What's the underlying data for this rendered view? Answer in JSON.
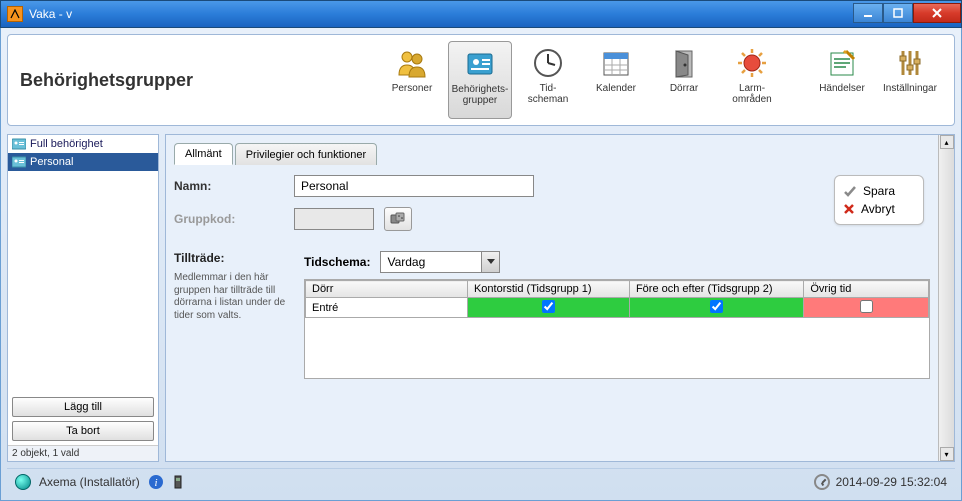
{
  "window": {
    "title": "Vaka - v"
  },
  "ribbon": {
    "title": "Behörighetsgrupper",
    "items": [
      {
        "label": "Personer"
      },
      {
        "label": "Behörighets-\ngrupper"
      },
      {
        "label": "Tid-\nscheman"
      },
      {
        "label": "Kalender"
      },
      {
        "label": "Dörrar"
      },
      {
        "label": "Larm-\nområden"
      },
      {
        "label": "Händelser"
      },
      {
        "label": "Inställningar"
      }
    ]
  },
  "sidebar": {
    "items": [
      {
        "label": "Full behörighet"
      },
      {
        "label": "Personal"
      }
    ],
    "add_label": "Lägg till",
    "remove_label": "Ta bort",
    "status": "2 objekt, 1 vald"
  },
  "tabs": [
    {
      "label": "Allmänt"
    },
    {
      "label": "Privilegier och funktioner"
    }
  ],
  "form": {
    "name_label": "Namn:",
    "name_value": "Personal",
    "groupcode_label": "Gruppkod:",
    "groupcode_value": ""
  },
  "actions": {
    "save": "Spara",
    "cancel": "Avbryt"
  },
  "access": {
    "heading": "Tillträde:",
    "description": "Medlemmar i den här gruppen har tillträde till dörrarna i listan under de tider som valts.",
    "schedule_label": "Tidschema:",
    "schedule_value": "Vardag",
    "columns": [
      "Dörr",
      "Kontorstid (Tidsgrupp 1)",
      "Före och efter (Tidsgrupp 2)",
      "Övrig tid"
    ],
    "rows": [
      {
        "door": "Entré",
        "col1": true,
        "col2": true,
        "col3": false
      }
    ]
  },
  "statusbar": {
    "user": "Axema (Installatör)",
    "datetime": "2014-09-29 15:32:04"
  }
}
